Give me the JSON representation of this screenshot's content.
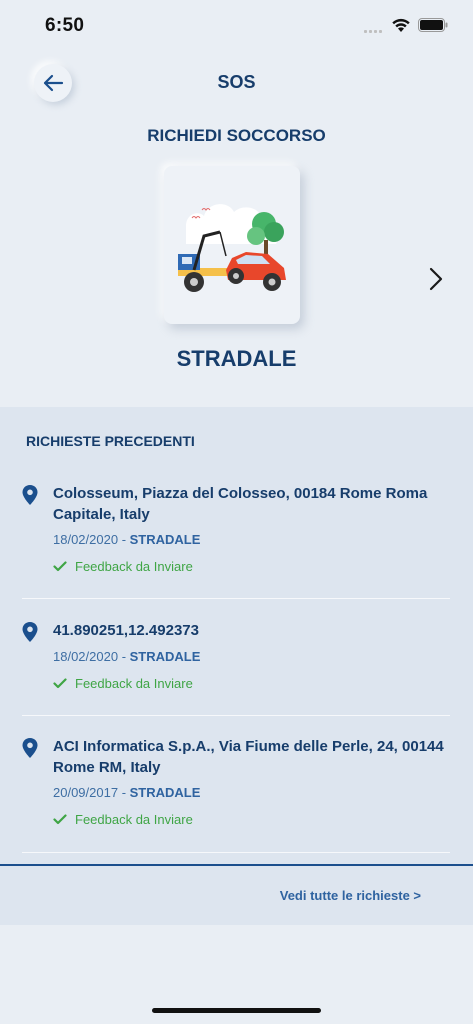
{
  "status_bar": {
    "time": "6:50"
  },
  "header": {
    "title": "SOS"
  },
  "request": {
    "section_title": "RICHIEDI SOCCORSO",
    "category": "STRADALE"
  },
  "history": {
    "title": "RICHIESTE PRECEDENTI",
    "items": [
      {
        "address": "Colosseum, Piazza del Colosseo, 00184 Rome Roma Capitale, Italy",
        "date": "18/02/2020",
        "separator": " - ",
        "type": "STRADALE",
        "feedback": "Feedback da Inviare"
      },
      {
        "address": "41.890251,12.492373",
        "date": "18/02/2020",
        "separator": " - ",
        "type": "STRADALE",
        "feedback": "Feedback da Inviare"
      },
      {
        "address": "ACI Informatica S.p.A., Via Fiume delle Perle, 24, 00144 Rome RM, Italy",
        "date": "20/09/2017",
        "separator": " - ",
        "type": "STRADALE",
        "feedback": "Feedback da Inviare"
      }
    ],
    "see_all": "Vedi tutte le richieste >"
  },
  "colors": {
    "primary": "#173d6b",
    "success": "#3fa545",
    "link": "#2f63a0"
  }
}
